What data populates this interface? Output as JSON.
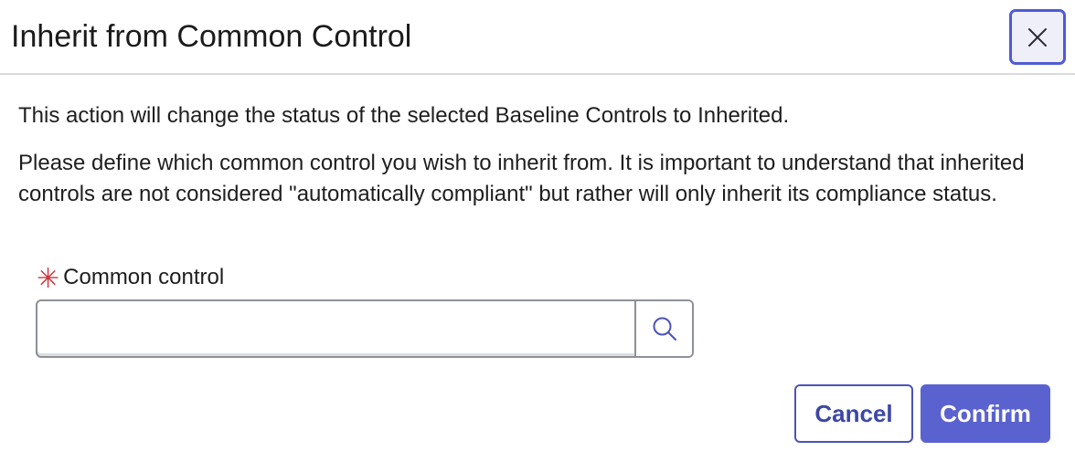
{
  "dialog": {
    "title": "Inherit from Common Control",
    "close_icon": "close-icon",
    "paragraph1": "This action will change the status of the selected Baseline Controls to Inherited.",
    "paragraph2": "Please define which common control you wish to inherit from. It is important to understand that inherited controls are not considered \"automatically compliant\" but rather will only inherit its compliance status.",
    "field": {
      "required_marker": "✳",
      "label": "Common control",
      "value": "",
      "placeholder": "",
      "search_icon": "search-icon"
    },
    "buttons": {
      "cancel_label": "Cancel",
      "confirm_label": "Confirm"
    }
  },
  "colors": {
    "accent": "#5a62cf",
    "required": "#d0343c",
    "border": "#8e9099"
  }
}
